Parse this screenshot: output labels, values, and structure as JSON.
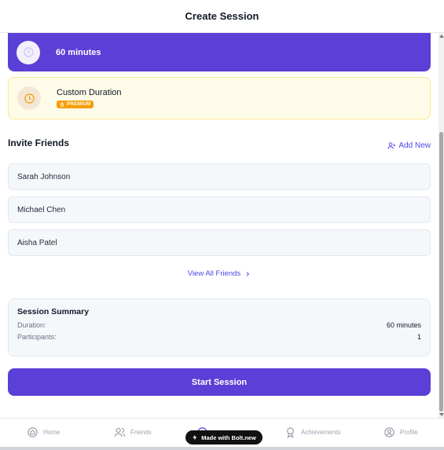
{
  "header": {
    "title": "Create Session"
  },
  "durations": {
    "selected": {
      "label": "60 minutes",
      "icon": "clock-icon"
    },
    "custom": {
      "label": "Custom Duration",
      "badge": "PREMIUM",
      "icon": "clock-icon"
    }
  },
  "invite": {
    "title": "Invite Friends",
    "add_new_label": "Add New",
    "friends": [
      "Sarah Johnson",
      "Michael Chen",
      "Aisha Patel"
    ],
    "view_all_label": "View All Friends"
  },
  "summary": {
    "title": "Session Summary",
    "duration_key": "Duration:",
    "duration_value": "60 minutes",
    "participants_key": "Participants:",
    "participants_value": "1"
  },
  "start_button_label": "Start Session",
  "nav": {
    "home": "Home",
    "friends": "Friends",
    "achievements": "Achievements",
    "profile": "Profile"
  },
  "bolt_badge": "Made with Bolt.new",
  "colors": {
    "accent": "#5b3fd6",
    "link": "#4f46e5",
    "premium": "#f59e0b",
    "custom_bg": "#fefce8"
  }
}
